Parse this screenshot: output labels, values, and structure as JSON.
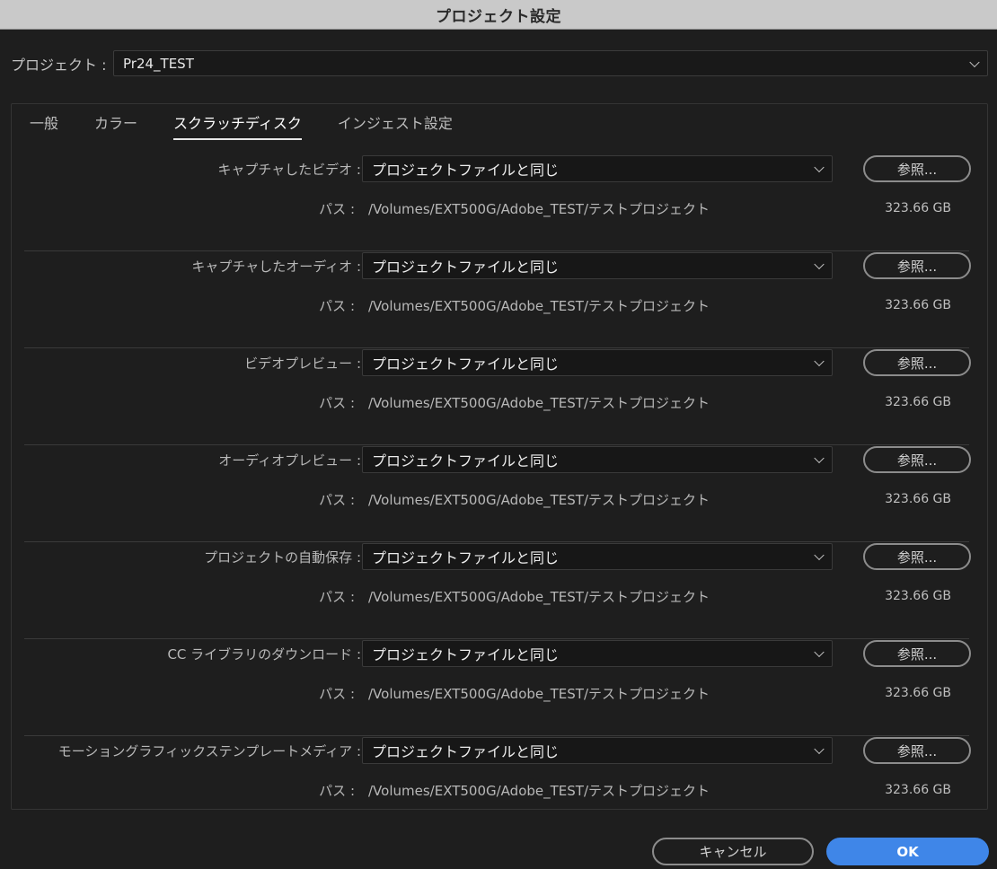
{
  "window": {
    "title": "プロジェクト設定"
  },
  "project": {
    "label": "プロジェクト :",
    "value": "Pr24_TEST"
  },
  "tabs": [
    {
      "label": "一般",
      "active": false
    },
    {
      "label": "カラー",
      "active": false
    },
    {
      "label": "スクラッチディスク",
      "active": true
    },
    {
      "label": "インジェスト設定",
      "active": false
    }
  ],
  "rows": [
    {
      "label": "キャプチャしたビデオ :",
      "value": "プロジェクトファイルと同じ",
      "browse": "参照...",
      "path_label": "パス :",
      "path": "/Volumes/EXT500G/Adobe_TEST/テストプロジェクト",
      "size": "323.66 GB"
    },
    {
      "label": "キャプチャしたオーディオ :",
      "value": "プロジェクトファイルと同じ",
      "browse": "参照...",
      "path_label": "パス :",
      "path": "/Volumes/EXT500G/Adobe_TEST/テストプロジェクト",
      "size": "323.66 GB"
    },
    {
      "label": "ビデオプレビュー :",
      "value": "プロジェクトファイルと同じ",
      "browse": "参照...",
      "path_label": "パス :",
      "path": "/Volumes/EXT500G/Adobe_TEST/テストプロジェクト",
      "size": "323.66 GB"
    },
    {
      "label": "オーディオプレビュー :",
      "value": "プロジェクトファイルと同じ",
      "browse": "参照...",
      "path_label": "パス :",
      "path": "/Volumes/EXT500G/Adobe_TEST/テストプロジェクト",
      "size": "323.66 GB"
    },
    {
      "label": "プロジェクトの自動保存 :",
      "value": "プロジェクトファイルと同じ",
      "browse": "参照...",
      "path_label": "パス :",
      "path": "/Volumes/EXT500G/Adobe_TEST/テストプロジェクト",
      "size": "323.66 GB"
    },
    {
      "label": "CC ライブラリのダウンロード :",
      "value": "プロジェクトファイルと同じ",
      "browse": "参照...",
      "path_label": "パス :",
      "path": "/Volumes/EXT500G/Adobe_TEST/テストプロジェクト",
      "size": "323.66 GB"
    },
    {
      "label": "モーショングラフィックステンプレートメディア :",
      "value": "プロジェクトファイルと同じ",
      "browse": "参照...",
      "path_label": "パス :",
      "path": "/Volumes/EXT500G/Adobe_TEST/テストプロジェクト",
      "size": "323.66 GB"
    }
  ],
  "footer": {
    "cancel_label": "キャンセル",
    "ok_label": "OK"
  },
  "colors": {
    "accent": "#3f86e8",
    "background": "#1e1e1e",
    "titlebar": "#c9c9c9"
  },
  "icons": {
    "dropdown": "chevron-down-icon"
  }
}
